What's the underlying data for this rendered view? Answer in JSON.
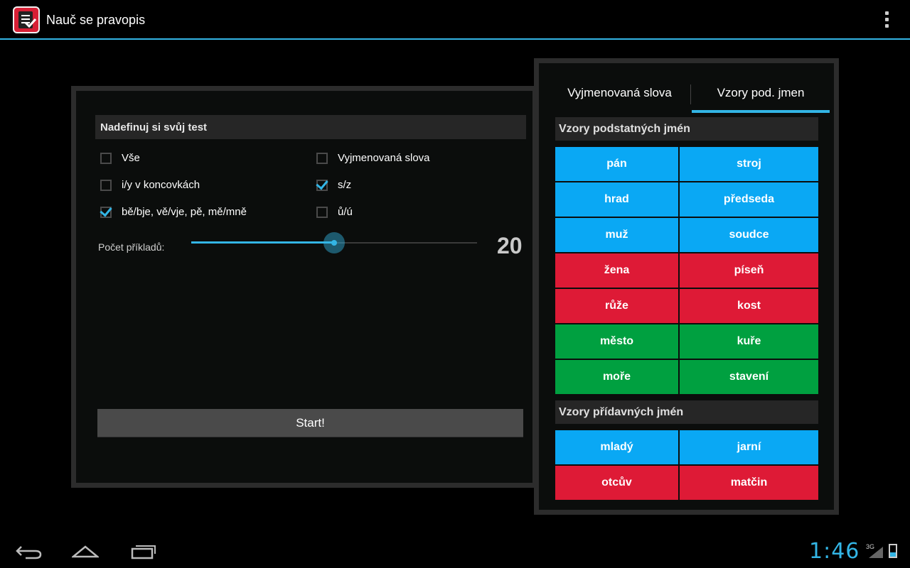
{
  "app": {
    "title": "Nauč se pravopis"
  },
  "left": {
    "header": "Nadefinuj si svůj test",
    "options": [
      {
        "label": "Vše",
        "checked": false
      },
      {
        "label": "Vyjmenovaná slova",
        "checked": false
      },
      {
        "label": "i/y v koncovkách",
        "checked": false
      },
      {
        "label": "s/z",
        "checked": true
      },
      {
        "label": "bě/bje, vě/vje, pě, mě/mně",
        "checked": true
      },
      {
        "label": "ů/ú",
        "checked": false
      }
    ],
    "count_label": "Počet příkladů:",
    "count_value": "20",
    "slider_fraction": 0.5,
    "start_label": "Start!"
  },
  "right": {
    "tabs": [
      {
        "label": "Vyjmenovaná slova",
        "selected": false
      },
      {
        "label": "Vzory pod. jmen",
        "selected": true
      }
    ],
    "noun_header": "Vzory podstatných jmén",
    "nouns": [
      {
        "left": "pán",
        "right": "stroj",
        "color": "#0aa8f4"
      },
      {
        "left": "hrad",
        "right": "předseda",
        "color": "#0aa8f4"
      },
      {
        "left": "muž",
        "right": "soudce",
        "color": "#0aa8f4"
      },
      {
        "left": "žena",
        "right": "píseň",
        "color": "#de1a36"
      },
      {
        "left": "růže",
        "right": "kost",
        "color": "#de1a36"
      },
      {
        "left": "město",
        "right": "kuře",
        "color": "#00a040"
      },
      {
        "left": "moře",
        "right": "stavení",
        "color": "#00a040"
      }
    ],
    "adj_header": "Vzory přídavných jmén",
    "adjectives": [
      {
        "left": "mladý",
        "right": "jarní",
        "color": "#0aa8f4"
      },
      {
        "left": "otcův",
        "right": "matčin",
        "color": "#de1a36"
      }
    ]
  },
  "status": {
    "time": "1:46",
    "network": "3G"
  }
}
